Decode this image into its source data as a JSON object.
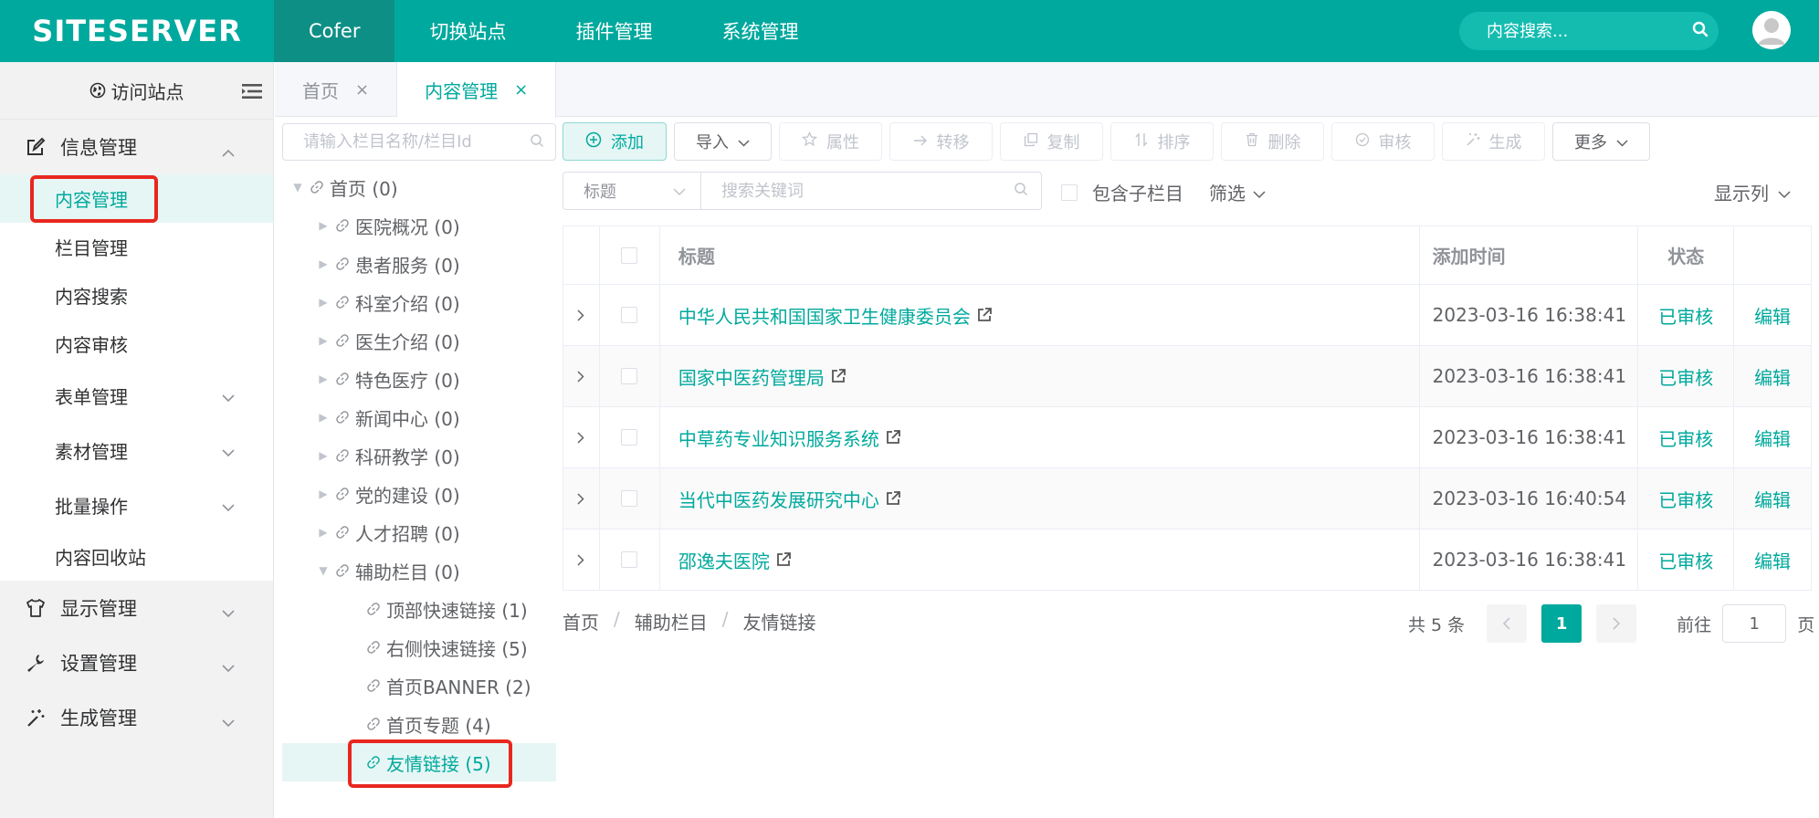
{
  "header": {
    "logo": "SITESERVER",
    "nav": [
      "Cofer",
      "切换站点",
      "插件管理",
      "系统管理"
    ],
    "search_placeholder": "内容搜索..."
  },
  "tabs": [
    {
      "label": "首页",
      "close": "×"
    },
    {
      "label": "内容管理",
      "close": "×"
    }
  ],
  "sidebar": {
    "visit_site": "访问站点",
    "group_info": "信息管理",
    "info_items": [
      "内容管理",
      "栏目管理",
      "内容搜索",
      "内容审核"
    ],
    "info_sub_groups": [
      "表单管理",
      "素材管理",
      "批量操作"
    ],
    "recycle": "内容回收站",
    "group_display": "显示管理",
    "group_settings": "设置管理",
    "group_generate": "生成管理"
  },
  "tree": {
    "search_placeholder": "请输入栏目名称/栏目Id",
    "root": "首页 (0)",
    "children": [
      "医院概况 (0)",
      "患者服务 (0)",
      "科室介绍 (0)",
      "医生介绍 (0)",
      "特色医疗 (0)",
      "新闻中心 (0)",
      "科研教学 (0)",
      "党的建设 (0)",
      "人才招聘 (0)",
      "辅助栏目 (0)"
    ],
    "aux_children": [
      "顶部快速链接 (1)",
      "右侧快速链接 (5)",
      "首页BANNER (2)",
      "首页专题 (4)",
      "友情链接 (5)"
    ]
  },
  "toolbar": {
    "add": "添加",
    "import": "导入",
    "attributes": "属性",
    "transfer": "转移",
    "copy": "复制",
    "sort": "排序",
    "delete": "删除",
    "audit": "审核",
    "generate": "生成",
    "more": "更多"
  },
  "filter": {
    "field": "标题",
    "keyword_placeholder": "搜索关键词",
    "include_children": "包含子栏目",
    "filter_label": "筛选",
    "columns_label": "显示列"
  },
  "table": {
    "headers": {
      "title": "标题",
      "time": "添加时间",
      "status": "状态"
    },
    "rows": [
      {
        "title": "中华人民共和国国家卫生健康委员会",
        "time": "2023-03-16 16:38:41",
        "status": "已审核",
        "action": "编辑"
      },
      {
        "title": "国家中医药管理局",
        "time": "2023-03-16 16:38:41",
        "status": "已审核",
        "action": "编辑"
      },
      {
        "title": "中草药专业知识服务系统",
        "time": "2023-03-16 16:38:41",
        "status": "已审核",
        "action": "编辑"
      },
      {
        "title": "当代中医药发展研究中心",
        "time": "2023-03-16 16:40:54",
        "status": "已审核",
        "action": "编辑"
      },
      {
        "title": "邵逸夫医院",
        "time": "2023-03-16 16:38:41",
        "status": "已审核",
        "action": "编辑"
      }
    ]
  },
  "breadcrumb": [
    "首页",
    "辅助栏目",
    "友情链接"
  ],
  "breadcrumb_sep": "/",
  "pager": {
    "total": "共 5 条",
    "current": "1",
    "goto_prefix": "前往",
    "goto_value": "1",
    "goto_suffix": "页"
  },
  "colors": {
    "accent": "#00a99d",
    "highlight_box": "#e8271f"
  }
}
